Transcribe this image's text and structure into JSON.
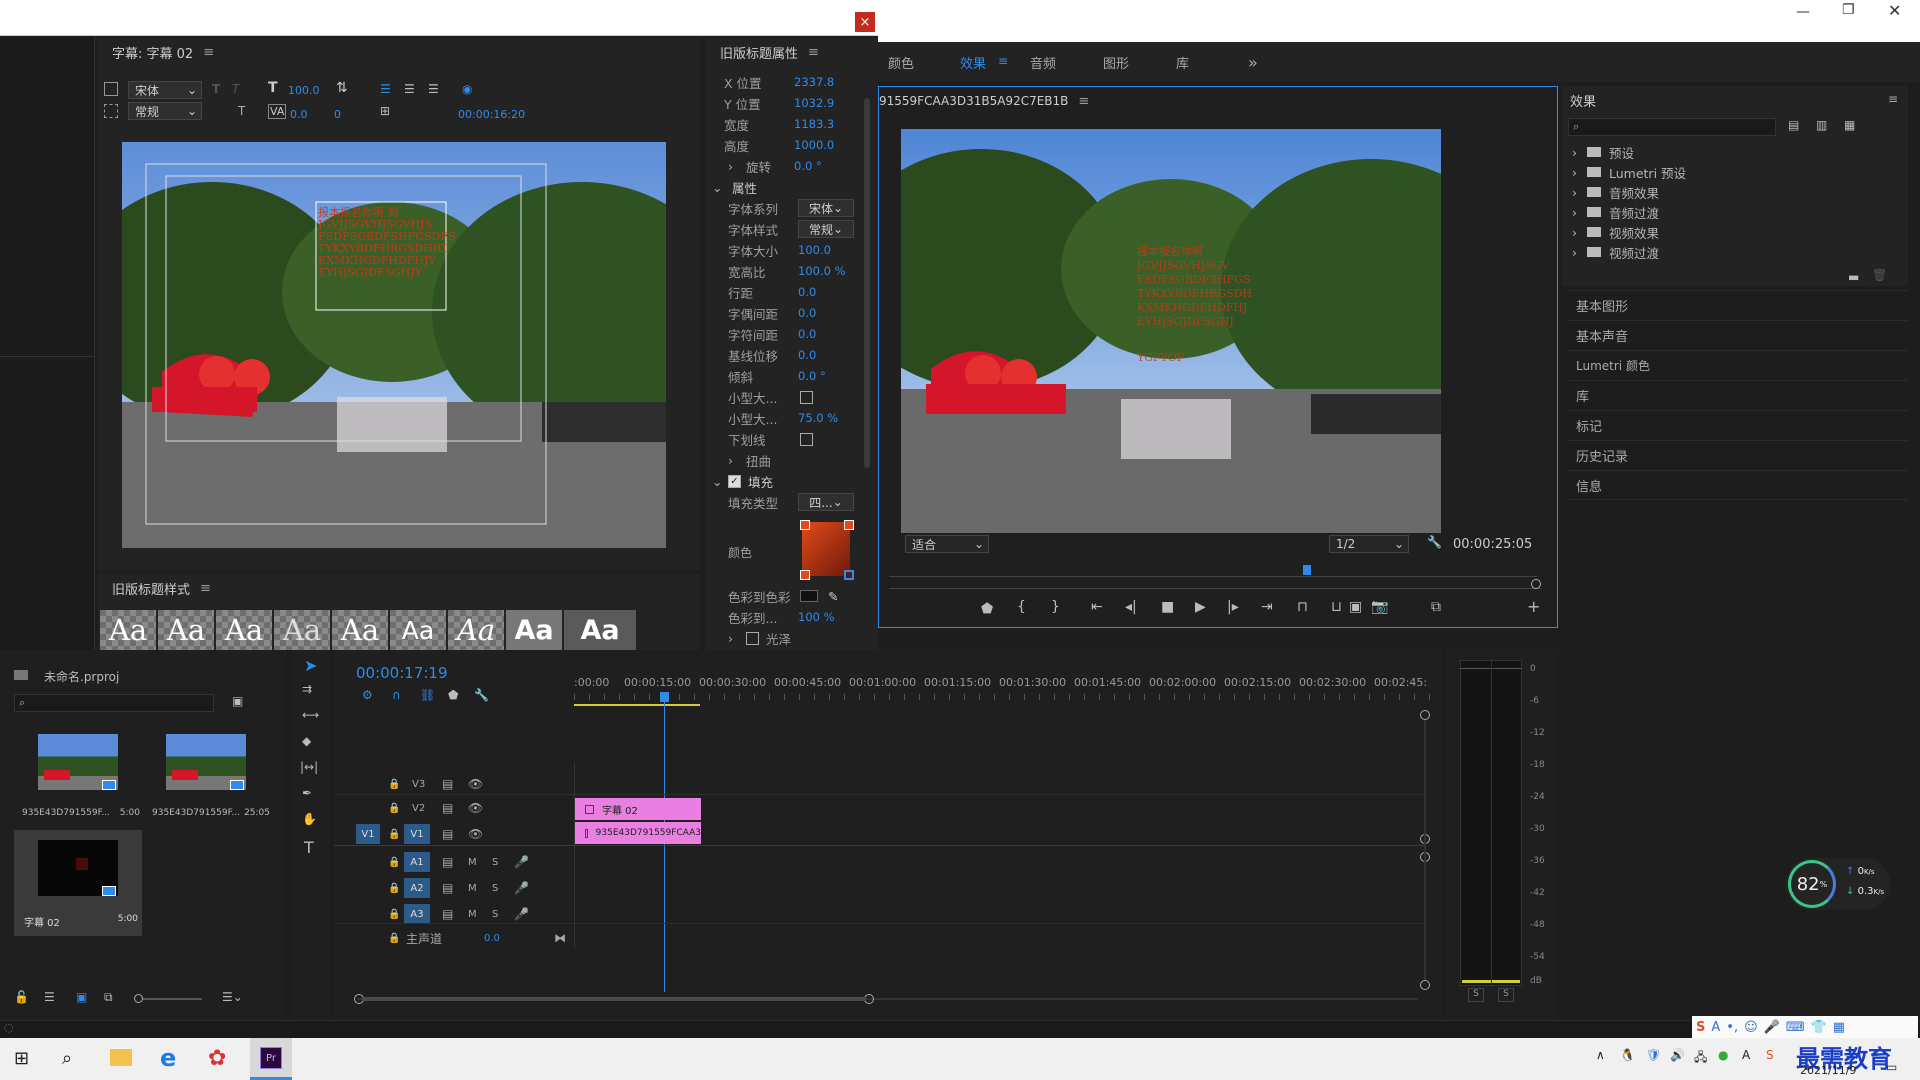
{
  "title_window": {
    "close": "×"
  },
  "title_editor": {
    "header": "字幕: 字幕 02",
    "font_family": "宋体",
    "font_style": "常规",
    "font_size": "100.0",
    "tracking": "0.0",
    "leading": "0",
    "timecode": "00:00:16:20"
  },
  "title_props": {
    "header": "旧版标题属性",
    "rows": [
      {
        "label": "X 位置",
        "value": "2337.8"
      },
      {
        "label": "Y 位置",
        "value": "1032.9"
      },
      {
        "label": "宽度",
        "value": "1183.3"
      },
      {
        "label": "高度",
        "value": "1000.0"
      },
      {
        "label": "旋转",
        "value": "0.0 °"
      }
    ],
    "attributes_title": "属性",
    "attr_rows": [
      {
        "label": "字体系列",
        "value": "宋体"
      },
      {
        "label": "字体样式",
        "value": "常规"
      },
      {
        "label": "字体大小",
        "value": "100.0"
      },
      {
        "label": "宽高比",
        "value": "100.0 %"
      },
      {
        "label": "行距",
        "value": "0.0"
      },
      {
        "label": "字偶间距",
        "value": "0.0"
      },
      {
        "label": "字符间距",
        "value": "0.0"
      },
      {
        "label": "基线位移",
        "value": "0.0"
      },
      {
        "label": "倾斜",
        "value": "0.0 °"
      },
      {
        "label": "小型大...",
        "value": ""
      },
      {
        "label": "小型大...",
        "value": "75.0 %"
      },
      {
        "label": "下划线",
        "value": ""
      }
    ],
    "distort": "扭曲",
    "fill_title": "填充",
    "fill_type_label": "填充类型",
    "fill_type_value": "四...",
    "color_label": "颜色",
    "color_to_label": "色彩到色彩",
    "color_to2_label": "色彩到...",
    "color_to2_value": "100 %",
    "sheen": "光泽"
  },
  "title_styles": {
    "header": "旧版标题样式",
    "swatch": "Aa"
  },
  "workspace_tabs": [
    "颜色",
    "效果",
    "音频",
    "图形",
    "库"
  ],
  "more": "»",
  "program": {
    "header": "91559FCAA3D31B5A92C7EB1B",
    "fit": "适合",
    "res": "1/2",
    "timecode": "00:00:25:05"
  },
  "effects": {
    "header": "效果",
    "items": [
      "预设",
      "Lumetri 预设",
      "音频效果",
      "音频过渡",
      "视频效果",
      "视频过渡"
    ]
  },
  "side_panels": [
    "基本图形",
    "基本声音",
    "Lumetri 颜色",
    "库",
    "标记",
    "历史记录",
    "信息"
  ],
  "project": {
    "name": "未命名.prproj",
    "items": [
      {
        "name": "935E43D791559F...",
        "dur": "5:00"
      },
      {
        "name": "935E43D791559F...",
        "dur": "25:05"
      },
      {
        "name": "字幕 02",
        "dur": "5:00"
      }
    ]
  },
  "timeline": {
    "timecode": "00:00:17:19",
    "ticks": [
      ":00:00",
      "00:00:15:00",
      "00:00:30:00",
      "00:00:45:00",
      "00:01:00:00",
      "00:01:15:00",
      "00:01:30:00",
      "00:01:45:00",
      "00:02:00:00",
      "00:02:15:00",
      "00:02:30:00",
      "00:02:45:"
    ],
    "tracks": [
      "V3",
      "V2",
      "V1",
      "A1",
      "A2",
      "A3"
    ],
    "master": "主声道",
    "master_val": "0.0",
    "clip_title": "字幕 02",
    "clip_video": "935E43D791559FCAA3"
  },
  "meter": {
    "labels": [
      "0",
      "-6",
      "-12",
      "-18",
      "-24",
      "-30",
      "-36",
      "-42",
      "-48",
      "-54",
      "dB"
    ],
    "s": "S"
  },
  "net": {
    "percent": "82",
    "unit": "%",
    "up": "0",
    "up_unit": "K/s",
    "down": "0.3",
    "down_unit": "K/s"
  },
  "taskbar": {
    "date": "2021/11/9",
    "watermark": "最需教育"
  },
  "colors": {
    "accent": "#2d8ceb",
    "clip_pink": "#e97fe0",
    "fill_red": "#c8391a"
  }
}
